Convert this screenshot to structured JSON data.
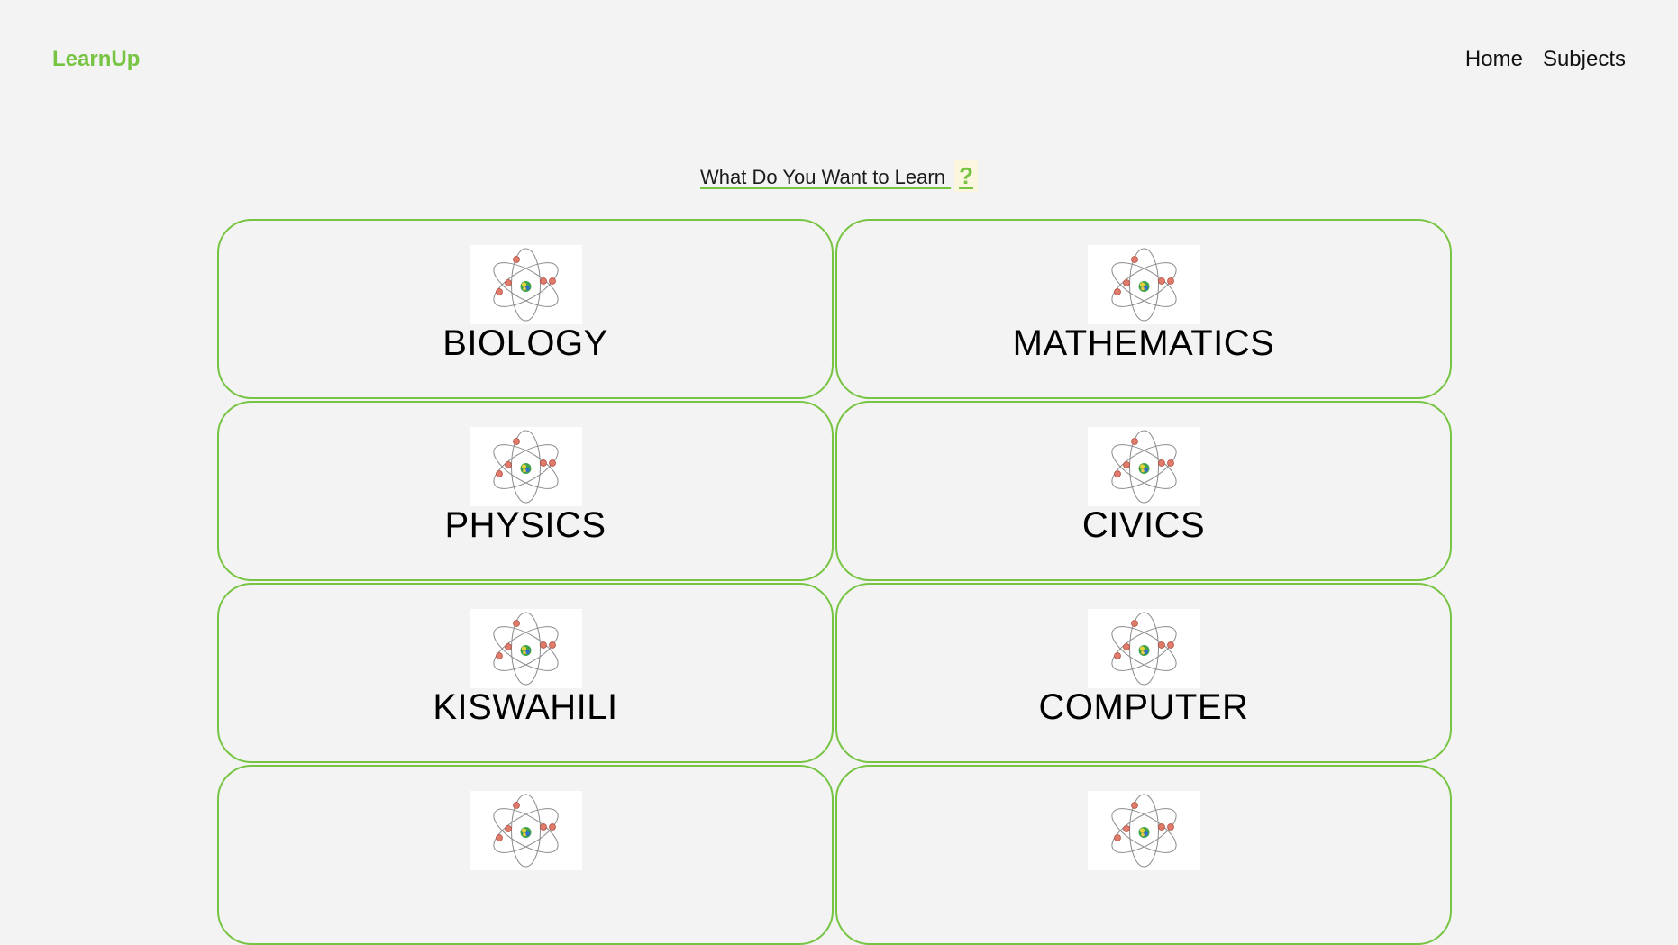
{
  "brand": "LearnUp",
  "nav": {
    "home": "Home",
    "subjects": "Subjects"
  },
  "heading": {
    "text": "What Do You Want to Learn ",
    "mark": "?"
  },
  "subjects": [
    {
      "name": "BIOLOGY",
      "icon": "atom-icon"
    },
    {
      "name": "MATHEMATICS",
      "icon": "atom-icon"
    },
    {
      "name": "PHYSICS",
      "icon": "atom-icon"
    },
    {
      "name": "CIVICS",
      "icon": "atom-icon"
    },
    {
      "name": "KISWAHILI",
      "icon": "atom-icon"
    },
    {
      "name": "COMPUTER",
      "icon": "atom-icon"
    },
    {
      "name": "",
      "icon": "atom-icon"
    },
    {
      "name": "",
      "icon": "atom-icon"
    }
  ],
  "colors": {
    "accent": "#76c442",
    "background": "#f3f3f3",
    "text": "#000000"
  }
}
